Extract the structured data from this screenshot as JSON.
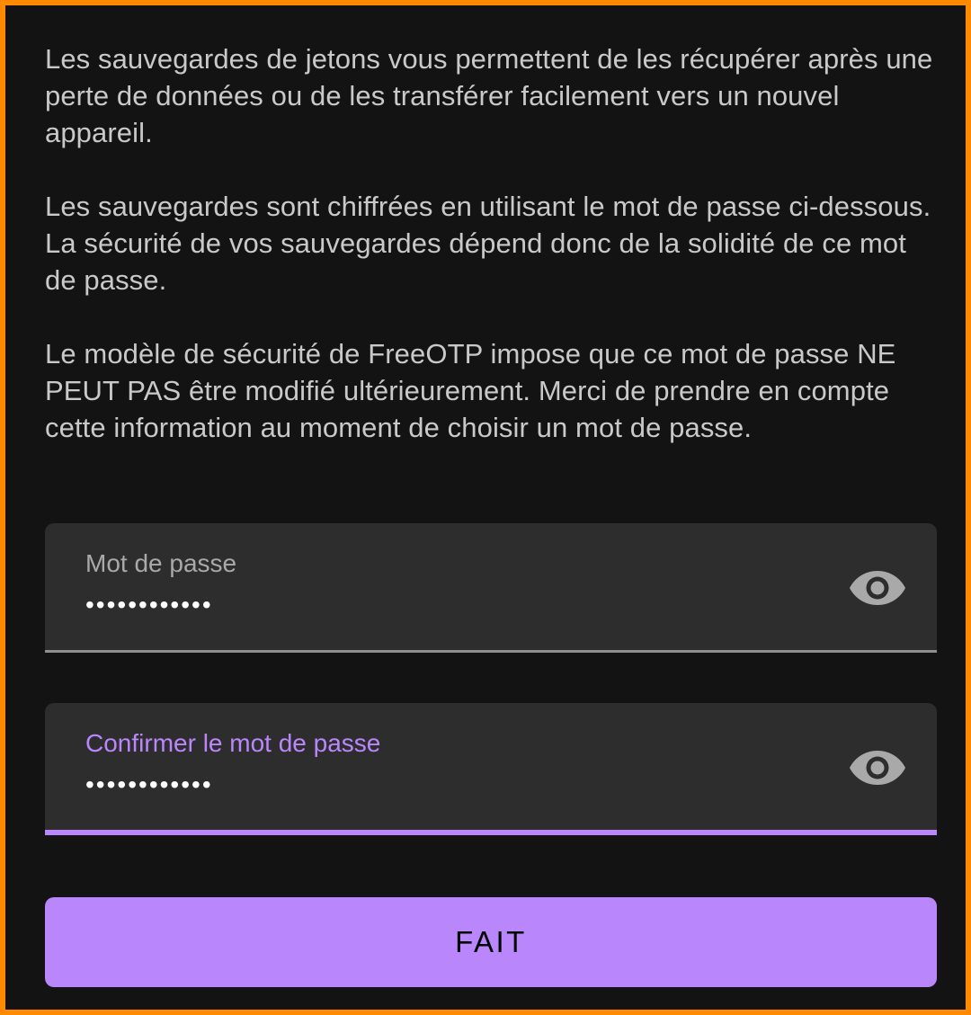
{
  "info": {
    "paragraph_1": "Les sauvegardes de jetons vous permettent de les récupérer après une perte de données ou de les transférer facilement vers un nouvel appareil.",
    "paragraph_2": "Les sauvegardes sont chiffrées en utilisant le mot de passe ci-dessous. La sécurité de vos sauvegardes dépend donc de la solidité de ce mot de passe.",
    "paragraph_3": "Le modèle de sécurité de FreeOTP impose que ce mot de passe NE PEUT PAS être modifié ultérieurement. Merci de prendre en compte cette information au moment de choisir un mot de passe."
  },
  "password_field": {
    "label": "Mot de passe",
    "value": "••••••••••••",
    "toggle_icon": "eye-icon",
    "state": "inactive"
  },
  "confirm_field": {
    "label": "Confirmer le mot de passe",
    "value": "••••••••••••",
    "toggle_icon": "eye-icon",
    "state": "focused"
  },
  "done_button": {
    "label": "FAIT"
  },
  "colors": {
    "background": "#131313",
    "frame": "#ff8a00",
    "accent": "#b987fb",
    "field_background": "#2d2d2d",
    "text": "#c9c9c9"
  }
}
